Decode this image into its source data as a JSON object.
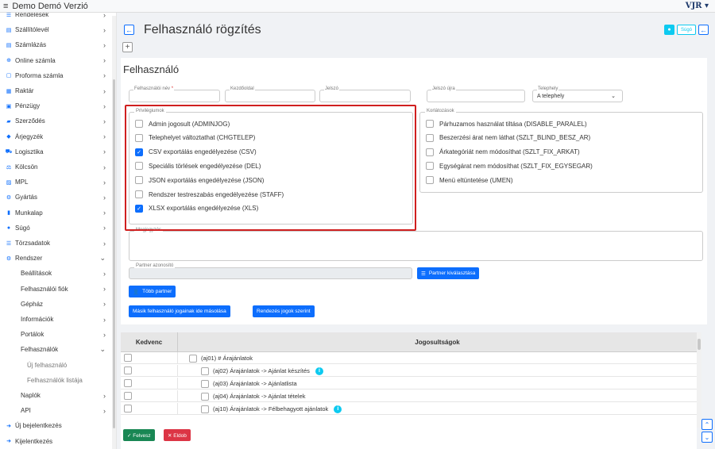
{
  "app": {
    "menu_icon": "hamburger-icon",
    "title": "Demo Demó Verzió",
    "brand": "VJR ▾"
  },
  "sidebar": {
    "items": [
      {
        "label": "Rendelések",
        "icon": "☰",
        "chevron": "›"
      },
      {
        "label": "Szállítólevél",
        "icon": "▤",
        "chevron": "›"
      },
      {
        "label": "Számlázás",
        "icon": "▤",
        "chevron": "›"
      },
      {
        "label": "Online számla",
        "icon": "⊕",
        "chevron": "›"
      },
      {
        "label": "Proforma számla",
        "icon": "▢",
        "chevron": "›"
      },
      {
        "label": "Raktár",
        "icon": "▦",
        "chevron": "›"
      },
      {
        "label": "Pénzügy",
        "icon": "▣",
        "chevron": "›"
      },
      {
        "label": "Szerződés",
        "icon": "▰",
        "chevron": "›"
      },
      {
        "label": "Árjegyzék",
        "icon": "◆",
        "chevron": "›"
      },
      {
        "label": "Logisztika",
        "icon": "⛟",
        "chevron": "›"
      },
      {
        "label": "Kölcsön",
        "icon": "⚖",
        "chevron": "›"
      },
      {
        "label": "MPL",
        "icon": "▨",
        "chevron": "›"
      },
      {
        "label": "Gyártás",
        "icon": "⚙",
        "chevron": "›"
      },
      {
        "label": "Munkalap",
        "icon": "▮",
        "chevron": "›"
      },
      {
        "label": "Súgó",
        "icon": "●",
        "chevron": "›"
      },
      {
        "label": "Törzsadatok",
        "icon": "☰",
        "chevron": "›"
      },
      {
        "label": "Rendszer",
        "icon": "⚙",
        "chevron": "⌄"
      }
    ],
    "sub_items": [
      {
        "label": "Beállítások",
        "chevron": "›"
      },
      {
        "label": "Felhasználói fiók",
        "chevron": "›"
      },
      {
        "label": "Gépház",
        "chevron": "›"
      },
      {
        "label": "Információk",
        "chevron": "›"
      },
      {
        "label": "Portálok",
        "chevron": "›"
      },
      {
        "label": "Felhasználók",
        "chevron": "⌄"
      }
    ],
    "sub_sub_items": [
      {
        "label": "Új felhasználó"
      },
      {
        "label": "Felhasználók listája"
      }
    ],
    "after_items": [
      {
        "label": "Naplók",
        "chevron": "›"
      },
      {
        "label": "API",
        "chevron": "›"
      }
    ],
    "bottom_items": [
      {
        "label": "Új bejelentkezés",
        "icon": "➜"
      },
      {
        "label": "Kijelentkezés",
        "icon": "➜"
      }
    ]
  },
  "header": {
    "back_icon": "←",
    "title": "Felhasználó rögzítés",
    "help_icon": "●",
    "help_label": "Súgó",
    "back2_icon": "←",
    "plus_label": "+"
  },
  "form": {
    "heading": "Felhasználó",
    "fields": {
      "username_label": "Felhasználói név",
      "username_req": "*",
      "homepage_label": "Kezdőoldal",
      "password_label": "Jelszó",
      "password2_label": "Jelszó újra",
      "site_label": "Telephely",
      "site_value": "A telephely",
      "site_caret": "⌄"
    },
    "privileges": {
      "label": "Privilégiumok",
      "items": [
        {
          "label": "Admin jogosult (ADMINJOG)",
          "checked": false,
          "mark": ""
        },
        {
          "label": "Telephelyet változtathat (CHGTELEP)",
          "checked": false,
          "mark": ""
        },
        {
          "label": "CSV exportálás engedélyezése (CSV)",
          "checked": true,
          "mark": "✓"
        },
        {
          "label": "Speciális törlések engedélyezése (DEL)",
          "checked": false,
          "mark": ""
        },
        {
          "label": "JSON exportálás engedélyezése (JSON)",
          "checked": false,
          "mark": ""
        },
        {
          "label": "Rendszer testreszabás engedélyezése (STAFF)",
          "checked": false,
          "mark": ""
        },
        {
          "label": "XLSX exportálás engedélyezése (XLS)",
          "checked": true,
          "mark": "✓"
        }
      ]
    },
    "restrictions": {
      "label": "Korlátozások",
      "items": [
        {
          "label": "Párhuzamos használat tiltása (DISABLE_PARALEL)",
          "checked": false
        },
        {
          "label": "Beszerzési árat nem láthat (SZLT_BLIND_BESZ_AR)",
          "checked": false
        },
        {
          "label": "Árkategóriát nem módosíthat (SZLT_FIX_ARKAT)",
          "checked": false
        },
        {
          "label": "Egységárat nem módosíthat (SZLT_FIX_EGYSEGAR)",
          "checked": false
        },
        {
          "label": "Menü eltüntetése (UMEN)",
          "checked": false
        }
      ]
    },
    "note_label": "Megjegyzés",
    "partner_label": "Partner azonosító",
    "partner_select_label": "Partner kiválasztása",
    "more_partner_label": "Több partner",
    "copy_rights_label": "Másik felhasználó jogainak ide másolása",
    "sort_rights_label": "Rendezés jogok szerint"
  },
  "table": {
    "col_fav": "Kedvenc",
    "col_perm": "Jogosultságok",
    "rows": [
      {
        "text": "(aj01) # Árajánlatok",
        "level": 0,
        "info": false
      },
      {
        "text": "(aj02)  Árajánlatok -> Ajánlat készítés",
        "level": 1,
        "info": true,
        "info_mark": "i"
      },
      {
        "text": "(aj03)  Árajánlatok -> Ajánlatlista",
        "level": 1,
        "info": false
      },
      {
        "text": "(aj04)  Árajánlatok -> Ajánlat tételek",
        "level": 1,
        "info": false
      },
      {
        "text": "(aj10)  Árajánlatok -> Félbehagyott ajánlatok",
        "level": 1,
        "info": true,
        "info_mark": "i"
      }
    ]
  },
  "actions": {
    "save_label": "✓  Felvesz",
    "discard_label": "✕  Eldob"
  },
  "scroll": {
    "up": "⌃",
    "down": "⌄"
  },
  "colors": {
    "primary": "#0d6efd",
    "info": "#0dcaf0",
    "success": "#198754",
    "danger": "#dc3545",
    "highlight": "#d01f1f"
  }
}
